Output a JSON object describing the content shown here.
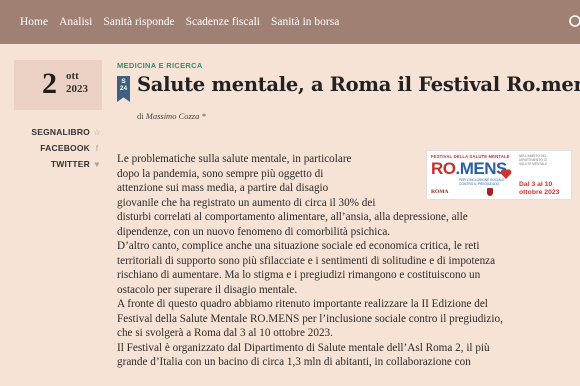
{
  "nav": {
    "items": [
      "Home",
      "Analisi",
      "Sanità risponde",
      "Scadenze fiscali",
      "Sanità in borsa"
    ],
    "search_icon": "search-icon"
  },
  "date": {
    "day": "2",
    "month": "ott",
    "year": "2023"
  },
  "share": {
    "bookmark": "SEGNALIBRO",
    "facebook": "FACEBOOK",
    "twitter": "TWITTER",
    "bookmark_icon": "☆",
    "facebook_icon": "f",
    "twitter_icon": "♥"
  },
  "article": {
    "category": "MEDICINA E RICERCA",
    "ribbon_top": "S",
    "ribbon_bottom": "24",
    "title": "Salute mentale, a Roma il Festival Ro.mens",
    "byline_prefix": "di",
    "author": "Massimo Cozza *",
    "paragraphs": [
      [
        "Le problematiche sulla salute mentale, in particolare",
        "dopo la pandemia, sono sempre più oggetto di",
        "attenzione sui mass media, a partire dal disagio",
        "giovanile che ha registrato un aumento di circa il 30% dei",
        "disturbi correlati al comportamento alimentare, all’ansia, alla depressione, alle",
        "dipendenze, con un nuovo fenomeno di comorbilità psichica."
      ],
      [
        "D’altro canto, complice anche una situazione sociale ed economica critica, le reti",
        "territoriali di supporto sono più sfilacciate e i sentimenti di solitudine e di impotenza",
        "rischiano di aumentare. Ma lo stigma e i pregiudizi rimangono e costituiscono un",
        "ostacolo per superare il disagio mentale."
      ],
      [
        "A fronte di questo quadro abbiamo ritenuto importante realizzare la II Edizione del",
        "Festival della Salute Mentale RO.MENS per l’inclusione sociale contro il pregiudizio,",
        "che si svolgerà a Roma dal 3 al 10 ottobre 2023."
      ],
      [
        "Il Festival è organizzato dal Dipartimento di Salute mentale dell’Asl Roma 2, il più",
        "grande d’Italia con un bacino di circa 1,3 mln di abitanti, in collaborazione con"
      ]
    ]
  },
  "banner": {
    "festival_label": "FESTIVAL DELLA SALUTE MENTALE",
    "logo_ro": "RO",
    "logo_dot": ".",
    "logo_mens": "MENS",
    "subtitle_1": "PER L'INCLUSIONE SOCIALE",
    "subtitle_2": "CONTRO IL PREGIUDIZIO",
    "roma": "ROMA",
    "right_info_1": "NELL'AMBITO DEL",
    "right_info_2": "DIPARTIMENTO DI",
    "right_info_3": "SALUTE MENTALE",
    "dates_1": "Dal 3 al 10",
    "dates_2": "ottobre 2023",
    "brand_red": "#c4312f",
    "brand_blue": "#2b5ea8"
  },
  "colors": {
    "nav_bg": "#a08072",
    "page_bg": "#f7e3d6",
    "category": "#3e8a6b",
    "ribbon": "#3f5f80"
  }
}
